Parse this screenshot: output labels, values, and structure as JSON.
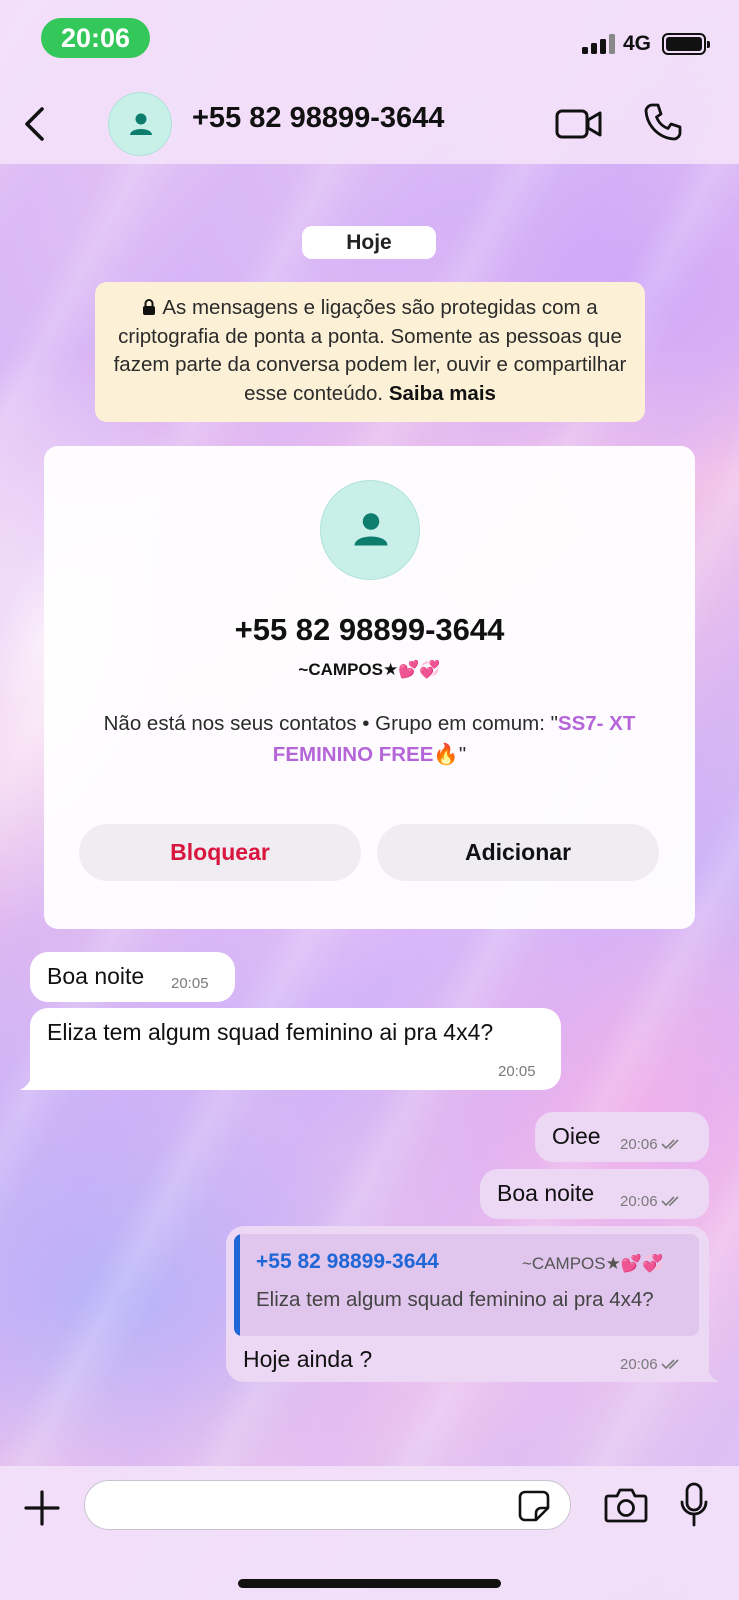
{
  "status_bar": {
    "time": "20:06",
    "network": "4G"
  },
  "header": {
    "title": "+55 82 98899-3644"
  },
  "date_chip": "Hoje",
  "encryption": {
    "text": "As mensagens e ligações são protegidas com a criptografia de ponta a ponta. Somente as pessoas que fazem parte da conversa podem ler, ouvir e compartilhar esse conteúdo.",
    "link": "Saiba mais"
  },
  "contact_card": {
    "phone": "+55 82 98899-3644",
    "name": "~CAMPOS★",
    "name_emoji": "💕💞",
    "info_prefix": "Não está nos seus contatos • Grupo em comum: \"",
    "group_name": "SS7- XT FEMININO FREE",
    "group_emoji": "🔥",
    "info_suffix": "\"",
    "block_label": "Bloquear",
    "add_label": "Adicionar"
  },
  "messages": [
    {
      "direction": "in",
      "text": "Boa noite",
      "time": "20:05"
    },
    {
      "direction": "in",
      "text": "Eliza tem algum squad feminino ai pra 4x4?",
      "time": "20:05"
    },
    {
      "direction": "out",
      "text": "Oiee",
      "time": "20:06"
    },
    {
      "direction": "out",
      "text": "Boa noite",
      "time": "20:06"
    },
    {
      "direction": "out",
      "text": "Hoje ainda ?",
      "time": "20:06",
      "quote": {
        "author": "+55 82 98899-3644",
        "author_tag": "~CAMPOS★",
        "author_tag_emoji": "💕💞",
        "text": "Eliza tem algum squad feminino ai pra 4x4?"
      }
    }
  ],
  "composer": {
    "placeholder": ""
  },
  "icons": {
    "back": "chevron-left-icon",
    "video": "video-camera-icon",
    "phone": "phone-icon",
    "lock": "lock-icon",
    "plus": "plus-icon",
    "sticker": "sticker-icon",
    "camera": "camera-icon",
    "mic": "microphone-icon",
    "read": "double-check-icon"
  },
  "colors": {
    "status_pill": "#34c759",
    "block": "#d8163f",
    "link": "#1f66d6",
    "group": "#b565d8",
    "outgoing": "#ecd8f4",
    "notice": "#fcf1d6"
  }
}
